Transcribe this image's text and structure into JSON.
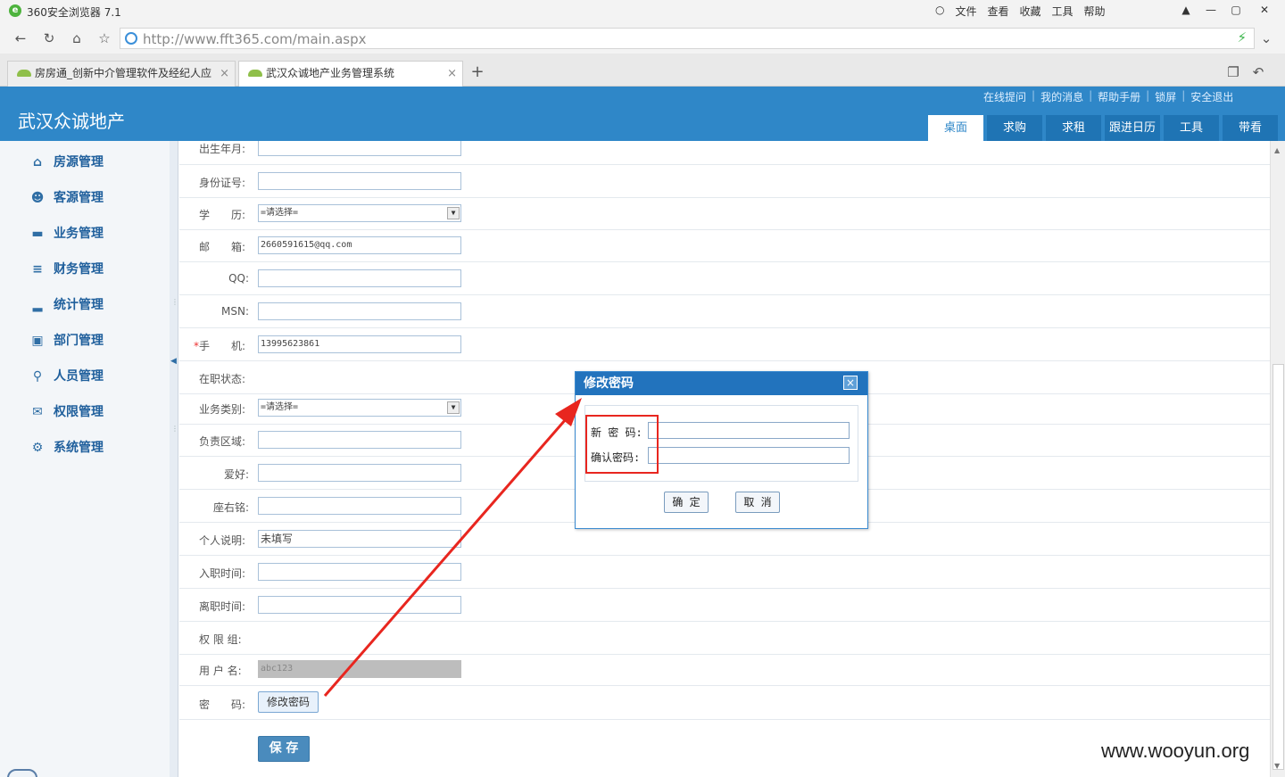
{
  "browser": {
    "title": "360安全浏览器 7.1",
    "menus": [
      "文件",
      "查看",
      "收藏",
      "工具",
      "帮助"
    ],
    "url": "http://www.fft365.com/main.aspx",
    "tabs": [
      {
        "label": "房房通_创新中介管理软件及经纪人应"
      },
      {
        "label": "武汉众诚地产业务管理系统"
      }
    ]
  },
  "header": {
    "brand": "武汉众诚地产",
    "top_links": [
      "在线提问",
      "我的消息",
      "帮助手册",
      "锁屏",
      "安全退出"
    ],
    "nav_tabs": [
      {
        "label": "桌面",
        "active": true
      },
      {
        "label": "求购"
      },
      {
        "label": "求租"
      },
      {
        "label": "跟进日历"
      },
      {
        "label": "工具"
      },
      {
        "label": "带看"
      }
    ]
  },
  "sidebar": {
    "items": [
      {
        "label": "房源管理",
        "icon": "home-icon"
      },
      {
        "label": "客源管理",
        "icon": "users-icon"
      },
      {
        "label": "业务管理",
        "icon": "car-icon"
      },
      {
        "label": "财务管理",
        "icon": "finance-icon"
      },
      {
        "label": "统计管理",
        "icon": "bar-chart-icon"
      },
      {
        "label": "部门管理",
        "icon": "org-chart-icon"
      },
      {
        "label": "人员管理",
        "icon": "paperclip-icon"
      },
      {
        "label": "权限管理",
        "icon": "chat-icon"
      },
      {
        "label": "系统管理",
        "icon": "gear-icon"
      }
    ]
  },
  "form": {
    "rows": [
      {
        "label": "出生年月:",
        "value": ""
      },
      {
        "label": "身份证号:",
        "value": ""
      },
      {
        "label": "学　　历:",
        "value": "=请选择="
      },
      {
        "label": "邮　　箱:",
        "value": "2660591615@qq.com"
      },
      {
        "label": "QQ:",
        "value": ""
      },
      {
        "label": "MSN:",
        "value": ""
      },
      {
        "label": "手　　机:",
        "value": "13995623861",
        "required_mark": "*"
      },
      {
        "label": "在职状态:"
      },
      {
        "label": "业务类别:",
        "value": "=请选择="
      },
      {
        "label": "负责区域:",
        "value": ""
      },
      {
        "label": "爱好:",
        "value": ""
      },
      {
        "label": "座右铭:",
        "value": ""
      },
      {
        "label": "个人说明:",
        "value": "未填写"
      },
      {
        "label": "入职时间:",
        "value": ""
      },
      {
        "label": "离职时间:",
        "value": ""
      },
      {
        "label": "权 限 组:"
      },
      {
        "label": "用 户 名:",
        "value": "abc123"
      },
      {
        "label": "密　　码:",
        "button": "修改密码"
      }
    ],
    "save_label": "保 存"
  },
  "dialog": {
    "title": "修改密码",
    "close": "×",
    "new_password_label": "新 密 码:",
    "confirm_password_label": "确认密码:",
    "new_password_value": "",
    "confirm_password_value": "",
    "ok_label": "确 定",
    "cancel_label": "取 消"
  },
  "annotation": {
    "color": "#e8261f"
  },
  "watermark": "www.wooyun.org"
}
